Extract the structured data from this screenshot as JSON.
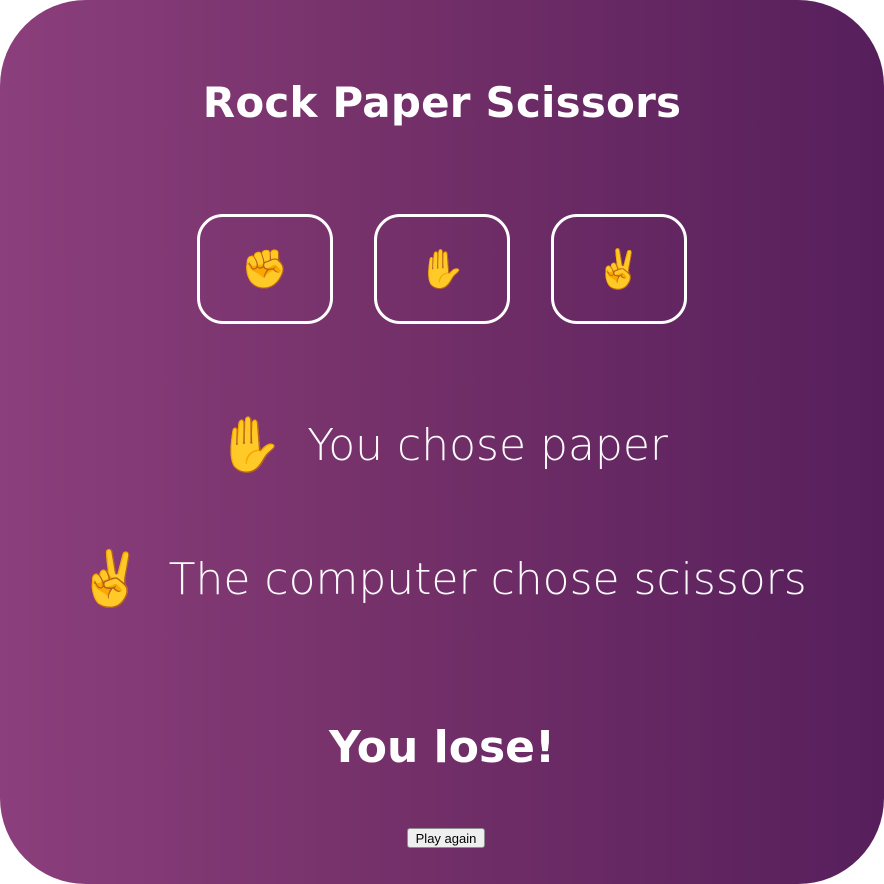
{
  "game": {
    "title": "Rock Paper Scissors"
  },
  "choices": [
    {
      "name": "rock",
      "icon": "raised-fist-icon",
      "glyph": "✊"
    },
    {
      "name": "paper",
      "icon": "raised-hand-icon",
      "glyph": "✋"
    },
    {
      "name": "scissors",
      "icon": "victory-hand-icon",
      "glyph": "✌️"
    }
  ],
  "result": {
    "player": {
      "glyph": "✋",
      "text": "You chose paper"
    },
    "computer": {
      "glyph": "✌️",
      "text": "The computer chose scissors"
    },
    "outcome": "You lose!"
  },
  "controls": {
    "play_again_label": "Play again"
  },
  "colors": {
    "gradient_start": "#8b3f7c",
    "gradient_end": "#561f5c",
    "text": "#ffffff"
  }
}
